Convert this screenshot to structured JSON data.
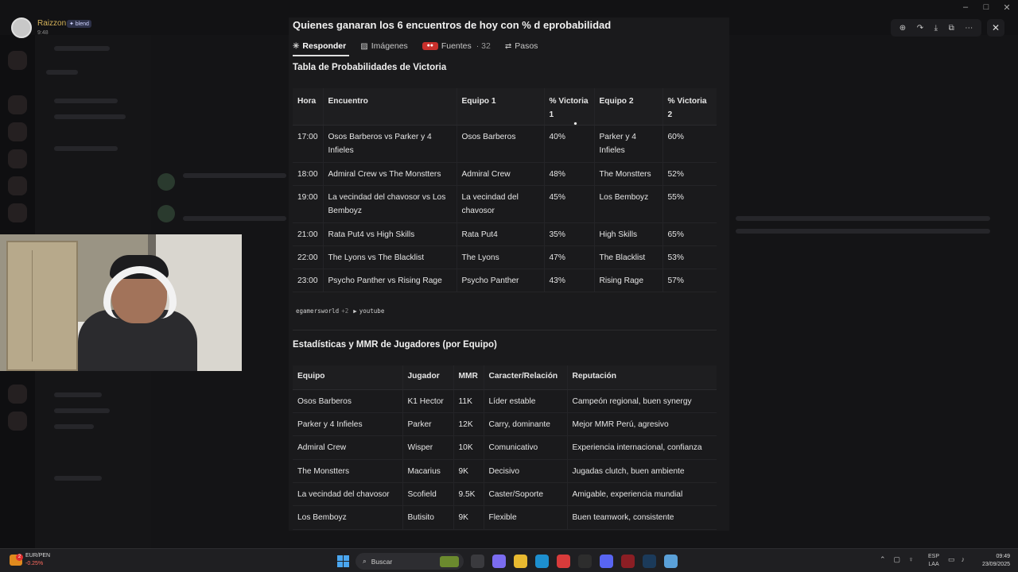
{
  "viewer": {
    "user_name": "Raizzon",
    "user_badge": "✦ blend",
    "user_time": "9:48",
    "toolbar_icons": [
      "zoom-icon",
      "share-icon",
      "download-icon",
      "open-external-icon",
      "more-icon"
    ],
    "close_symbol": "✕"
  },
  "window_controls": [
    "–",
    "□",
    "✕"
  ],
  "panel": {
    "question_title": "Quienes ganaran los 6 encuentros de hoy con % d eprobabilidad",
    "tabs": [
      {
        "label": "Responder",
        "icon": "✳",
        "active": true
      },
      {
        "label": "Imágenes",
        "icon": "▨"
      },
      {
        "label": "Fuentes",
        "icon": "src",
        "count": "· 32"
      },
      {
        "label": "Pasos",
        "icon": "⇄"
      }
    ],
    "table1_title": "Tabla de Probabilidades de Victoria",
    "table1": {
      "headers": [
        "Hora",
        "Encuentro",
        "Equipo 1",
        "% Victoria 1",
        "Equipo 2",
        "% Victoria 2"
      ],
      "rows": [
        [
          "17:00",
          "Osos Barberos vs Parker y 4 Infieles",
          "Osos Barberos",
          "40%",
          "Parker y 4 Infieles",
          "60%"
        ],
        [
          "18:00",
          "Admiral Crew vs The Monstters",
          "Admiral Crew",
          "48%",
          "The Monstters",
          "52%"
        ],
        [
          "19:00",
          "La vecindad del chavosor vs Los Bemboyz",
          "La vecindad del chavosor",
          "45%",
          "Los Bemboyz",
          "55%"
        ],
        [
          "21:00",
          "Rata Put4 vs High Skills",
          "Rata Put4",
          "35%",
          "High Skills",
          "65%"
        ],
        [
          "22:00",
          "The Lyons vs The Blacklist",
          "The Lyons",
          "47%",
          "The Blacklist",
          "53%"
        ],
        [
          "23:00",
          "Psycho Panther vs Rising Rage",
          "Psycho Panther",
          "43%",
          "Rising Rage",
          "57%"
        ]
      ]
    },
    "sources": [
      {
        "label": "egamersworld",
        "extra": "+2"
      },
      {
        "label": "youtube",
        "icon": "▶"
      }
    ],
    "table2_title": "Estadísticas y MMR de Jugadores (por Equipo)",
    "table2": {
      "headers": [
        "Equipo",
        "Jugador",
        "MMR",
        "Caracter/Relación",
        "Reputación"
      ],
      "rows": [
        [
          "Osos Barberos",
          "K1 Hector",
          "11K",
          "Líder estable",
          "Campeón regional, buen synergy"
        ],
        [
          "Parker y 4 Infieles",
          "Parker",
          "12K",
          "Carry, dominante",
          "Mejor MMR Perú, agresivo"
        ],
        [
          "Admiral Crew",
          "Wisper",
          "10K",
          "Comunicativo",
          "Experiencia internacional, confianza"
        ],
        [
          "The Monstters",
          "Macarius",
          "9K",
          "Decisivo",
          "Jugadas clutch, buen ambiente"
        ],
        [
          "La vecindad del chavosor",
          "Scofield",
          "9.5K",
          "Caster/Soporte",
          "Amigable, experiencia mundial"
        ],
        [
          "Los Bemboyz",
          "Butisito",
          "9K",
          "Flexible",
          "Buen teamwork, consistente"
        ]
      ]
    }
  },
  "taskbar": {
    "ticker_name": "EUR/PEN",
    "ticker_value": "-0.25%",
    "ticker_badge": "2",
    "search_placeholder": "Buscar",
    "lang_line1": "ESP",
    "lang_line2": "LAA",
    "time": "09:49",
    "date": "23/09/2025",
    "app_icons": [
      {
        "name": "task-view-icon",
        "color": "#3a3a3e"
      },
      {
        "name": "copilot-icon",
        "color": "#7b6cf0"
      },
      {
        "name": "file-explorer-icon",
        "color": "#e8b930"
      },
      {
        "name": "edge-icon",
        "color": "#1d8fcf"
      },
      {
        "name": "app-red-icon",
        "color": "#d83b3b"
      },
      {
        "name": "app-dark-icon",
        "color": "#2d2d2d"
      },
      {
        "name": "discord-icon",
        "color": "#5865f2"
      },
      {
        "name": "app-maroon-icon",
        "color": "#8b1e24"
      },
      {
        "name": "steam-icon",
        "color": "#1b3a5a"
      },
      {
        "name": "notepad-icon",
        "color": "#5aa0d8"
      }
    ]
  }
}
